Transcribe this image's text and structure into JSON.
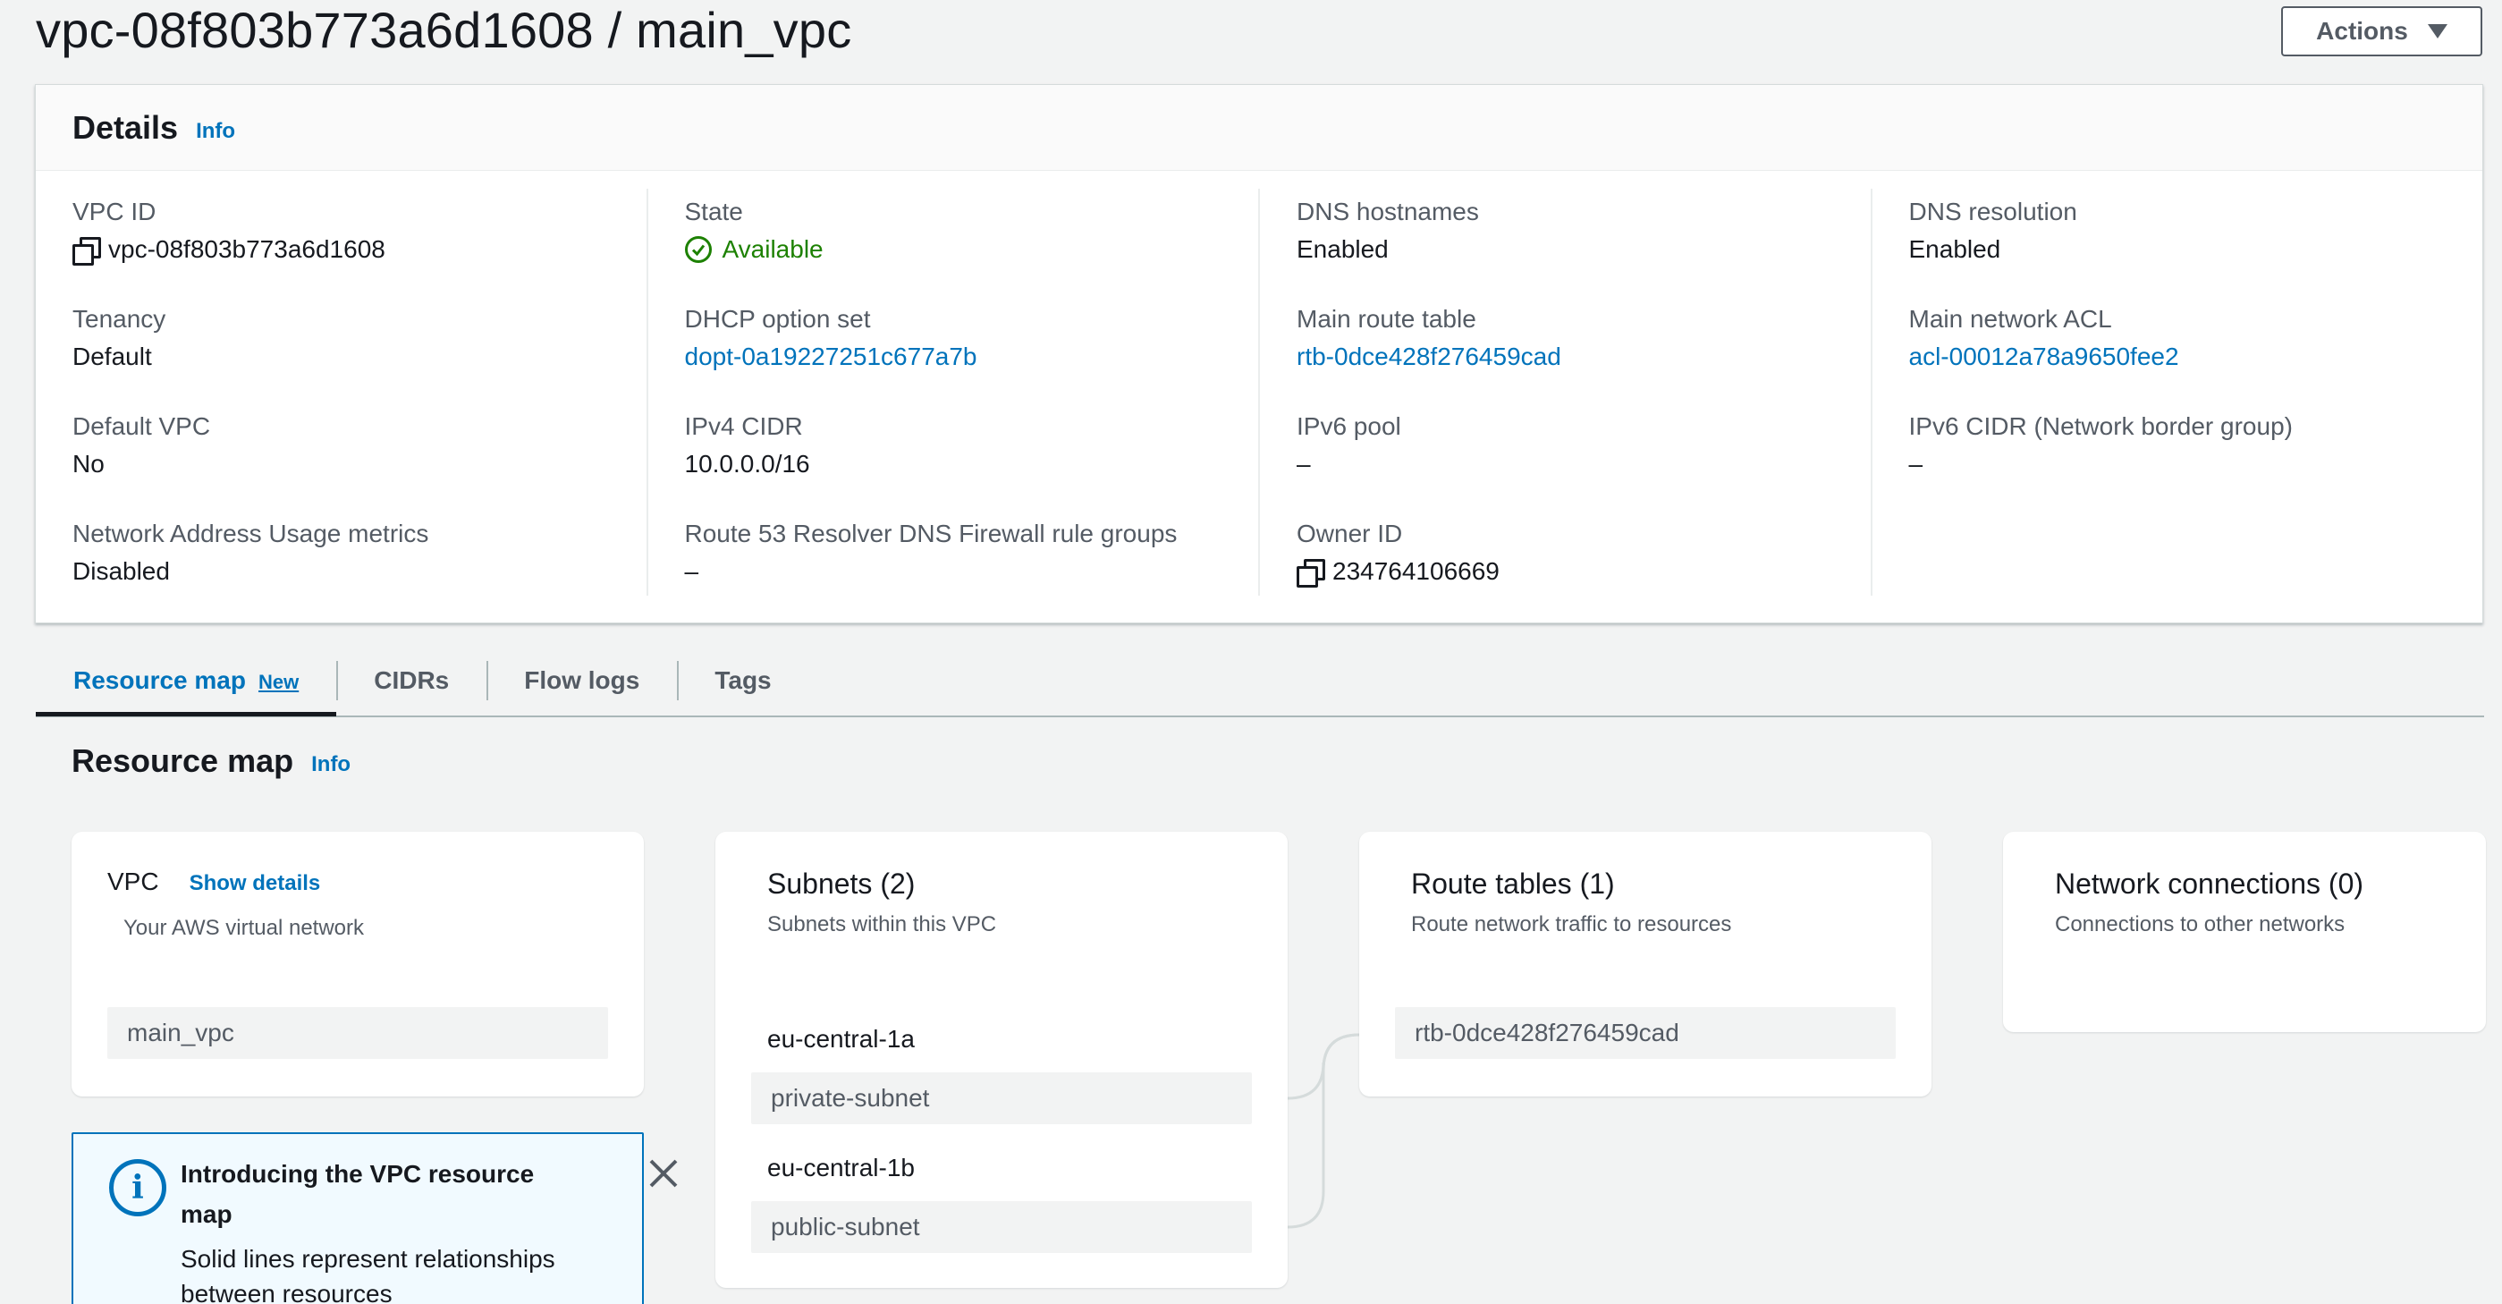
{
  "header": {
    "title": "vpc-08f803b773a6d1608 / main_vpc",
    "actions_label": "Actions"
  },
  "details": {
    "title": "Details",
    "info_label": "Info",
    "columns": [
      [
        {
          "label": "VPC ID",
          "value": "vpc-08f803b773a6d1608",
          "icon": "copy-icon"
        },
        {
          "label": "Tenancy",
          "value": "Default"
        },
        {
          "label": "Default VPC",
          "value": "No"
        },
        {
          "label": "Network Address Usage metrics",
          "value": "Disabled"
        }
      ],
      [
        {
          "label": "State",
          "value": "Available",
          "icon": "check-circle-icon",
          "status_color": "#1d8102"
        },
        {
          "label": "DHCP option set",
          "value": "dopt-0a19227251c677a7b",
          "link": true
        },
        {
          "label": "IPv4 CIDR",
          "value": "10.0.0.0/16"
        },
        {
          "label": "Route 53 Resolver DNS Firewall rule groups",
          "value": "–"
        }
      ],
      [
        {
          "label": "DNS hostnames",
          "value": "Enabled"
        },
        {
          "label": "Main route table",
          "value": "rtb-0dce428f276459cad",
          "link": true
        },
        {
          "label": "IPv6 pool",
          "value": "–"
        },
        {
          "label": "Owner ID",
          "value": "234764106669",
          "icon": "copy-icon"
        }
      ],
      [
        {
          "label": "DNS resolution",
          "value": "Enabled"
        },
        {
          "label": "Main network ACL",
          "value": "acl-00012a78a9650fee2",
          "link": true
        },
        {
          "label": "IPv6 CIDR (Network border group)",
          "value": "–"
        }
      ]
    ]
  },
  "tabs": [
    {
      "label": "Resource map",
      "badge": "New",
      "active": true
    },
    {
      "label": "CIDRs"
    },
    {
      "label": "Flow logs"
    },
    {
      "label": "Tags"
    }
  ],
  "resource_map": {
    "title": "Resource map",
    "info_label": "Info",
    "vpc_card": {
      "title": "VPC",
      "show_details": "Show details",
      "subtitle": "Your AWS virtual network",
      "item": "main_vpc"
    },
    "subnets_card": {
      "title": "Subnets (2)",
      "subtitle": "Subnets within this VPC",
      "groups": [
        {
          "az": "eu-central-1a",
          "subnet": "private-subnet"
        },
        {
          "az": "eu-central-1b",
          "subnet": "public-subnet"
        }
      ]
    },
    "route_tables_card": {
      "title": "Route tables (1)",
      "subtitle": "Route network traffic to resources",
      "item": "rtb-0dce428f276459cad"
    },
    "network_card": {
      "title": "Network connections (0)",
      "subtitle": "Connections to other networks"
    }
  },
  "alert": {
    "title": "Introducing the VPC resource map",
    "body": "Solid lines represent relationships between resources"
  },
  "colors": {
    "link": "#0073bb",
    "status_ok": "#1d8102",
    "page_bg": "#f2f3f3"
  }
}
